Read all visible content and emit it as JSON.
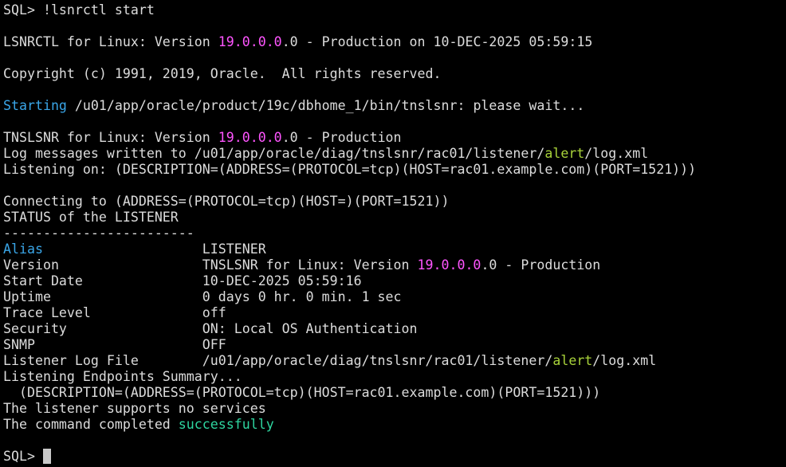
{
  "colors": {
    "background": "#000000",
    "default_text": "#dcdcdc",
    "version_magenta": "#ff55ff",
    "keyword_blue": "#3aa6e8",
    "path_green": "#a8d23a",
    "success_teal": "#2ed6a0",
    "cursor": "#c8c8c8"
  },
  "terminal": {
    "lines": [
      {
        "segments": [
          {
            "text": "SQL> !lsnrctl start",
            "color": "default"
          }
        ]
      },
      {
        "segments": []
      },
      {
        "segments": [
          {
            "text": "LSNRCTL for Linux: Version ",
            "color": "default"
          },
          {
            "text": "19.0.0.0",
            "color": "magenta"
          },
          {
            "text": ".0 - Production on 10-DEC-2025 05:59:15",
            "color": "default"
          }
        ]
      },
      {
        "segments": []
      },
      {
        "segments": [
          {
            "text": "Copyright (c) 1991, 2019, Oracle.  All rights reserved.",
            "color": "default"
          }
        ]
      },
      {
        "segments": []
      },
      {
        "segments": [
          {
            "text": "Starting",
            "color": "blue"
          },
          {
            "text": " /u01/app/oracle/product/19c/dbhome_1/bin/tnslsnr: please wait...",
            "color": "default"
          }
        ]
      },
      {
        "segments": []
      },
      {
        "segments": [
          {
            "text": "TNSLSNR for Linux: Version ",
            "color": "default"
          },
          {
            "text": "19.0.0.0",
            "color": "magenta"
          },
          {
            "text": ".0 - Production",
            "color": "default"
          }
        ]
      },
      {
        "segments": [
          {
            "text": "Log messages written to /u01/app/oracle/diag/tnslsnr/rac01/listener/",
            "color": "default"
          },
          {
            "text": "alert",
            "color": "green"
          },
          {
            "text": "/log.xml",
            "color": "default"
          }
        ]
      },
      {
        "segments": [
          {
            "text": "Listening on: (DESCRIPTION=(ADDRESS=(PROTOCOL=tcp)(HOST=rac01.example.com)(PORT=1521)))",
            "color": "default"
          }
        ]
      },
      {
        "segments": []
      },
      {
        "segments": [
          {
            "text": "Connecting to (ADDRESS=(PROTOCOL=tcp)(HOST=)(PORT=1521))",
            "color": "default"
          }
        ]
      },
      {
        "segments": [
          {
            "text": "STATUS of the LISTENER",
            "color": "default"
          }
        ]
      },
      {
        "segments": [
          {
            "text": "------------------------",
            "color": "default"
          }
        ]
      },
      {
        "segments": [
          {
            "text": "Alias",
            "color": "blue"
          },
          {
            "text": "                    LISTENER",
            "color": "default"
          }
        ]
      },
      {
        "segments": [
          {
            "text": "Version                  TNSLSNR for Linux: Version ",
            "color": "default"
          },
          {
            "text": "19.0.0.0",
            "color": "magenta"
          },
          {
            "text": ".0 - Production",
            "color": "default"
          }
        ]
      },
      {
        "segments": [
          {
            "text": "Start Date               10-DEC-2025 05:59:16",
            "color": "default"
          }
        ]
      },
      {
        "segments": [
          {
            "text": "Uptime                   0 days 0 hr. 0 min. 1 sec",
            "color": "default"
          }
        ]
      },
      {
        "segments": [
          {
            "text": "Trace Level              off",
            "color": "default"
          }
        ]
      },
      {
        "segments": [
          {
            "text": "Security                 ON: Local OS Authentication",
            "color": "default"
          }
        ]
      },
      {
        "segments": [
          {
            "text": "SNMP                     OFF",
            "color": "default"
          }
        ]
      },
      {
        "segments": [
          {
            "text": "Listener Log File        /u01/app/oracle/diag/tnslsnr/rac01/listener/",
            "color": "default"
          },
          {
            "text": "alert",
            "color": "green"
          },
          {
            "text": "/log.xml",
            "color": "default"
          }
        ]
      },
      {
        "segments": [
          {
            "text": "Listening Endpoints Summary...",
            "color": "default"
          }
        ]
      },
      {
        "segments": [
          {
            "text": "  (DESCRIPTION=(ADDRESS=(PROTOCOL=tcp)(HOST=rac01.example.com)(PORT=1521)))",
            "color": "default"
          }
        ]
      },
      {
        "segments": [
          {
            "text": "The listener supports no services",
            "color": "default"
          }
        ]
      },
      {
        "segments": [
          {
            "text": "The command completed ",
            "color": "default"
          },
          {
            "text": "successfully",
            "color": "teal"
          }
        ]
      },
      {
        "segments": []
      }
    ],
    "prompt": "SQL> ",
    "input_value": ""
  }
}
